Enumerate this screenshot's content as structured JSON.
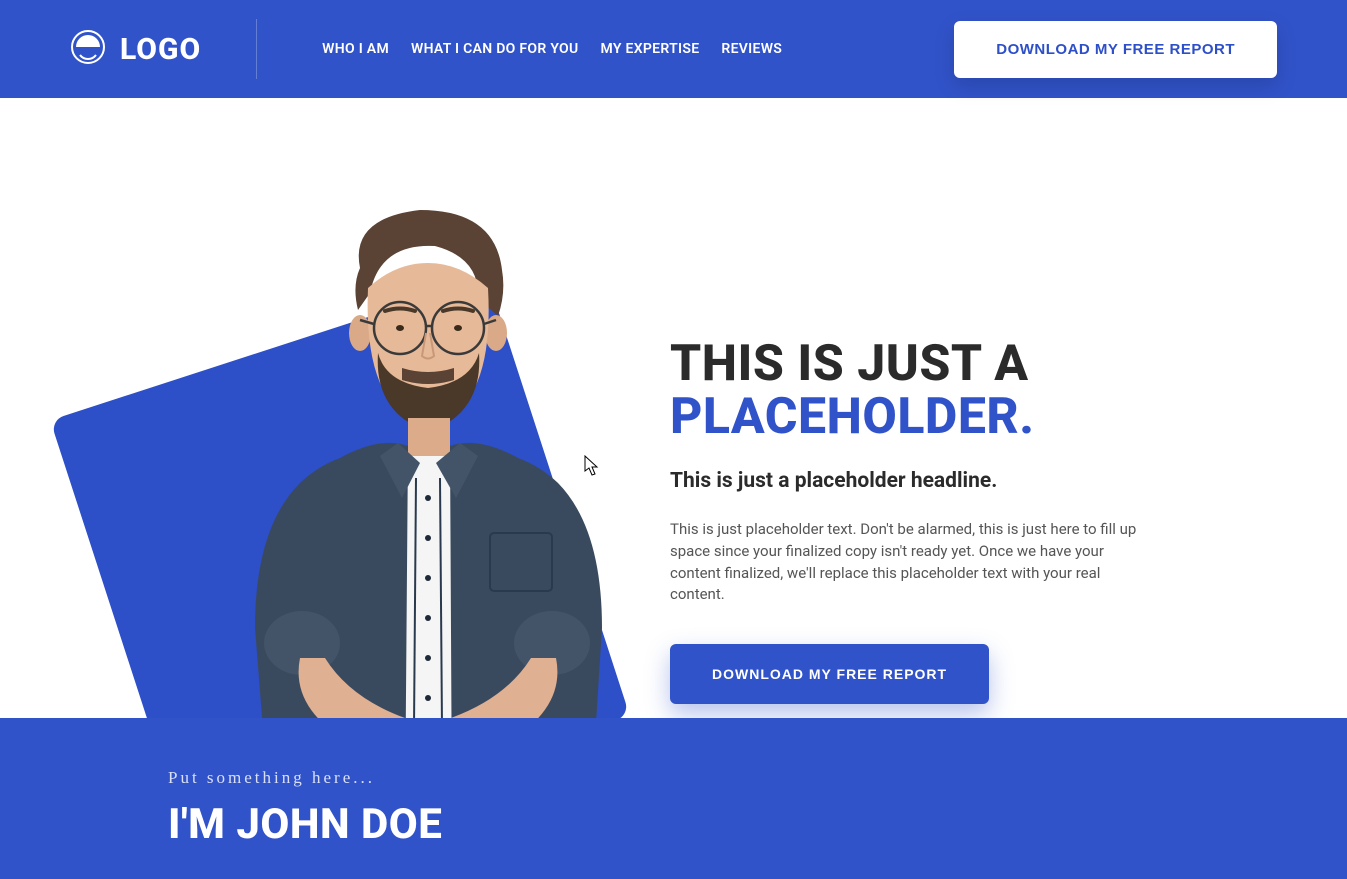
{
  "header": {
    "logo_text": "LOGO",
    "nav": [
      "WHO I AM",
      "WHAT I CAN DO FOR YOU",
      "MY EXPERTISE",
      "REVIEWS"
    ],
    "cta": "DOWNLOAD MY FREE REPORT"
  },
  "hero": {
    "headline_line1": "THIS IS JUST A",
    "headline_line2": "PLACEHOLDER.",
    "subheadline": "This is just a placeholder headline.",
    "body": "This is just placeholder text. Don't be alarmed, this is just here to fill up space since your finalized copy isn't ready yet. Once we have your content finalized, we'll replace this placeholder text with your real content.",
    "cta": "DOWNLOAD MY FREE REPORT"
  },
  "about": {
    "eyebrow": "Put something here...",
    "title": "I'M JOHN DOE"
  },
  "colors": {
    "primary": "#3153c9",
    "text_dark": "#2b2b2b"
  }
}
